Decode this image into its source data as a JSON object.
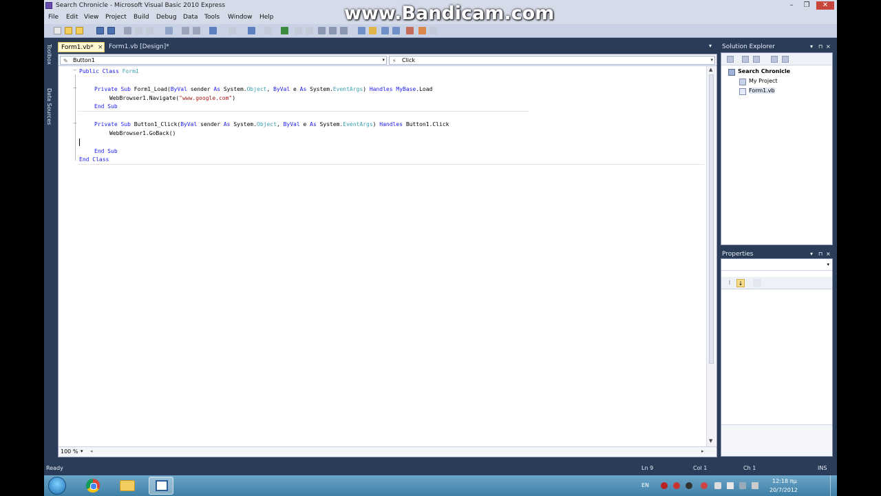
{
  "window": {
    "title": "Search Chronicle - Microsoft Visual Basic 2010 Express",
    "minimize": "–",
    "restore": "❐",
    "close": "✕"
  },
  "watermark": "www.Bandicam.com",
  "menu": [
    "File",
    "Edit",
    "View",
    "Project",
    "Build",
    "Debug",
    "Data",
    "Tools",
    "Window",
    "Help"
  ],
  "side_tools": {
    "toolbox": "Toolbox",
    "data_sources": "Data Sources"
  },
  "tabs": [
    {
      "label": "Form1.vb*",
      "active": true,
      "close": "×"
    },
    {
      "label": "Form1.vb [Design]*",
      "active": false
    }
  ],
  "editor": {
    "object_combo": "Button1",
    "event_combo": "Click",
    "zoom": "100 %",
    "code": {
      "l1_kw": "Public Class",
      "l1_ty": " Form1",
      "l3_kw1": "Private Sub",
      "l3_tx1": " Form1_Load(",
      "l3_kw2": "ByVal",
      "l3_tx2": " sender ",
      "l3_kw3": "As",
      "l3_tx3": " System.",
      "l3_ty1": "Object",
      "l3_tx4": ", ",
      "l3_kw4": "ByVal",
      "l3_tx5": " e ",
      "l3_kw5": "As",
      "l3_tx6": " System.",
      "l3_ty2": "EventArgs",
      "l3_tx7": ") ",
      "l3_kw6": "Handles",
      "l3_kw7": " MyBase",
      "l3_tx8": ".Load",
      "l4_tx1": "WebBrowser1.Navigate(",
      "l4_st": "\"www.google.com\"",
      "l4_tx2": ")",
      "l5_kw": "End Sub",
      "l7_kw1": "Private Sub",
      "l7_tx1": " Button1_Click(",
      "l7_kw2": "ByVal",
      "l7_tx2": " sender ",
      "l7_kw3": "As",
      "l7_tx3": " System.",
      "l7_ty1": "Object",
      "l7_tx4": ", ",
      "l7_kw4": "ByVal",
      "l7_tx5": " e ",
      "l7_kw5": "As",
      "l7_tx6": " System.",
      "l7_ty2": "EventArgs",
      "l7_tx7": ") ",
      "l7_kw6": "Handles",
      "l7_tx8": " Button1.Click",
      "l8_tx": "WebBrowser1.GoBack()",
      "l10_kw": "End Sub",
      "l11_kw": "End Class"
    }
  },
  "solution_explorer": {
    "title": "Solution Explorer",
    "items": [
      "Search Chronicle",
      "My Project",
      "Form1.vb"
    ]
  },
  "properties": {
    "title": "Properties"
  },
  "status": {
    "ready": "Ready",
    "ln": "Ln 9",
    "col": "Col 1",
    "ch": "Ch 1",
    "ins": "INS"
  },
  "taskbar": {
    "lang": "EN",
    "time": "12:18 πμ",
    "date": "20/7/2012"
  },
  "colors": {
    "keyword": "#1a1af0",
    "type": "#3aa0b0",
    "string": "#a31515",
    "ide_background": "#2b3c59"
  }
}
